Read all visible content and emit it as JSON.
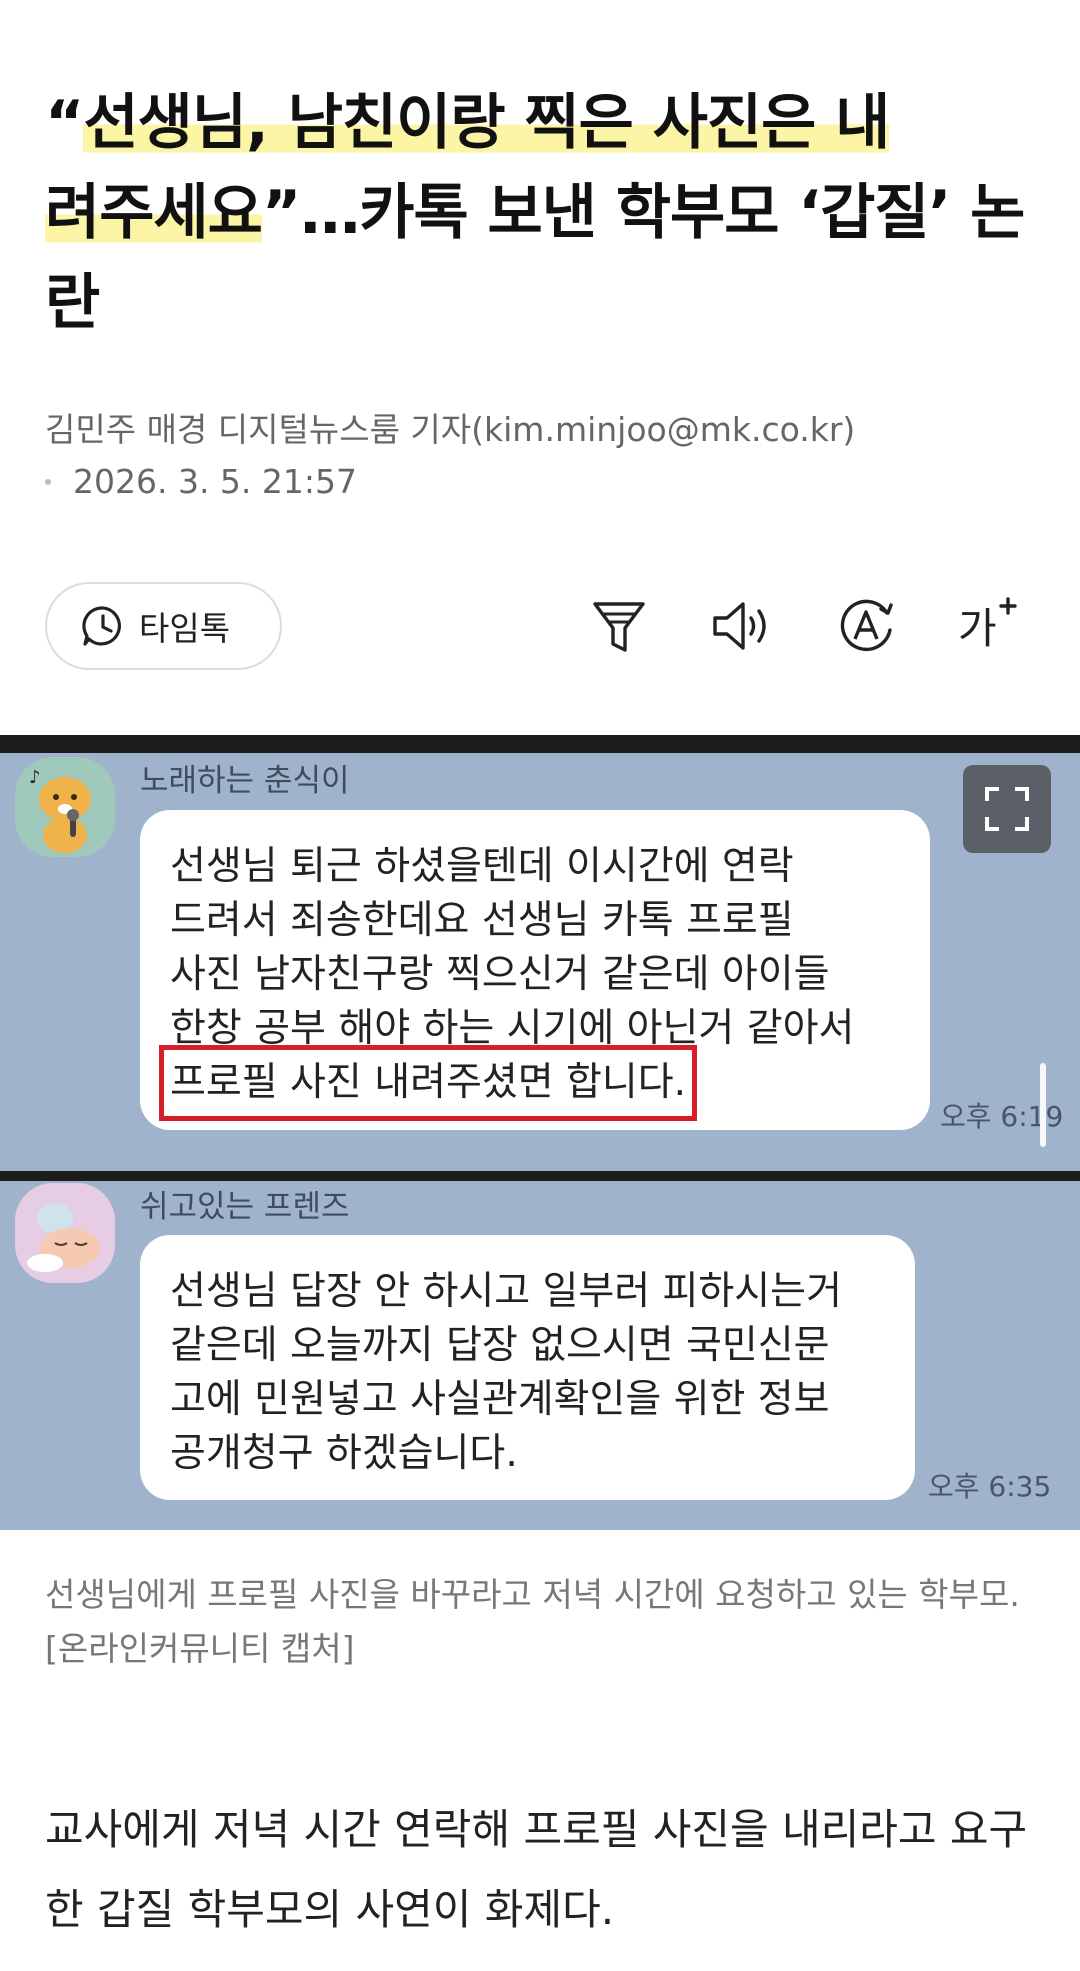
{
  "article": {
    "headline_part1": "“",
    "headline_hl1": "선생님, 남친이랑 찍은 사진은 내",
    "headline_hl2": "려주세요",
    "headline_part2": "”…카톡 보낸 학부모 ‘갑질’ 논란",
    "byline": "김민주 매경 디지털뉴스룸 기자(kim.minjoo@mk.co.kr)",
    "date": "2026. 3. 5. 21:57"
  },
  "toolbar": {
    "timetalk_label": "타임톡",
    "icons": [
      "filter-icon",
      "speaker-icon",
      "translate-icon",
      "font-size-icon"
    ],
    "font_size_glyph": "가"
  },
  "chat_image": {
    "message1": {
      "sender": "노래하는 춘식이",
      "lines": [
        "선생님 퇴근 하셨을텐데 이시간에 연락",
        "드려서 죄송한데요 선생님 카톡 프로필",
        "사진 남자친구랑 찍으신거 같은데 아이들",
        "한창 공부 해야 하는 시기에 아닌거 같아서",
        "프로필 사진 내려주셨면 합니다."
      ],
      "time": "오후 6:19"
    },
    "message2": {
      "sender": "쉬고있는 프렌즈",
      "lines": [
        "선생님 답장 안 하시고 일부러 피하시는거",
        "같은데 오늘까지 답장 없으시면 국민신문",
        "고에 민원넣고 사실관계확인을 위한 정보",
        "공개청구 하겠습니다."
      ],
      "time": "오후 6:35"
    },
    "chat_bg_color": "#9fb3cd",
    "highlight_color": "#d61f26"
  },
  "caption": "선생님에게 프로필 사진을 바꾸라고 저녁 시간에 요청하고 있는 학부모. [온라인커뮤니티 캡처]",
  "body": "교사에게 저녁 시간 연락해 프로필 사진을 내리라고 요구한 갑질 학부모의 사연이 화제다.",
  "colors": {
    "highlight": "#fdf5a6",
    "meta_text": "#666666"
  }
}
